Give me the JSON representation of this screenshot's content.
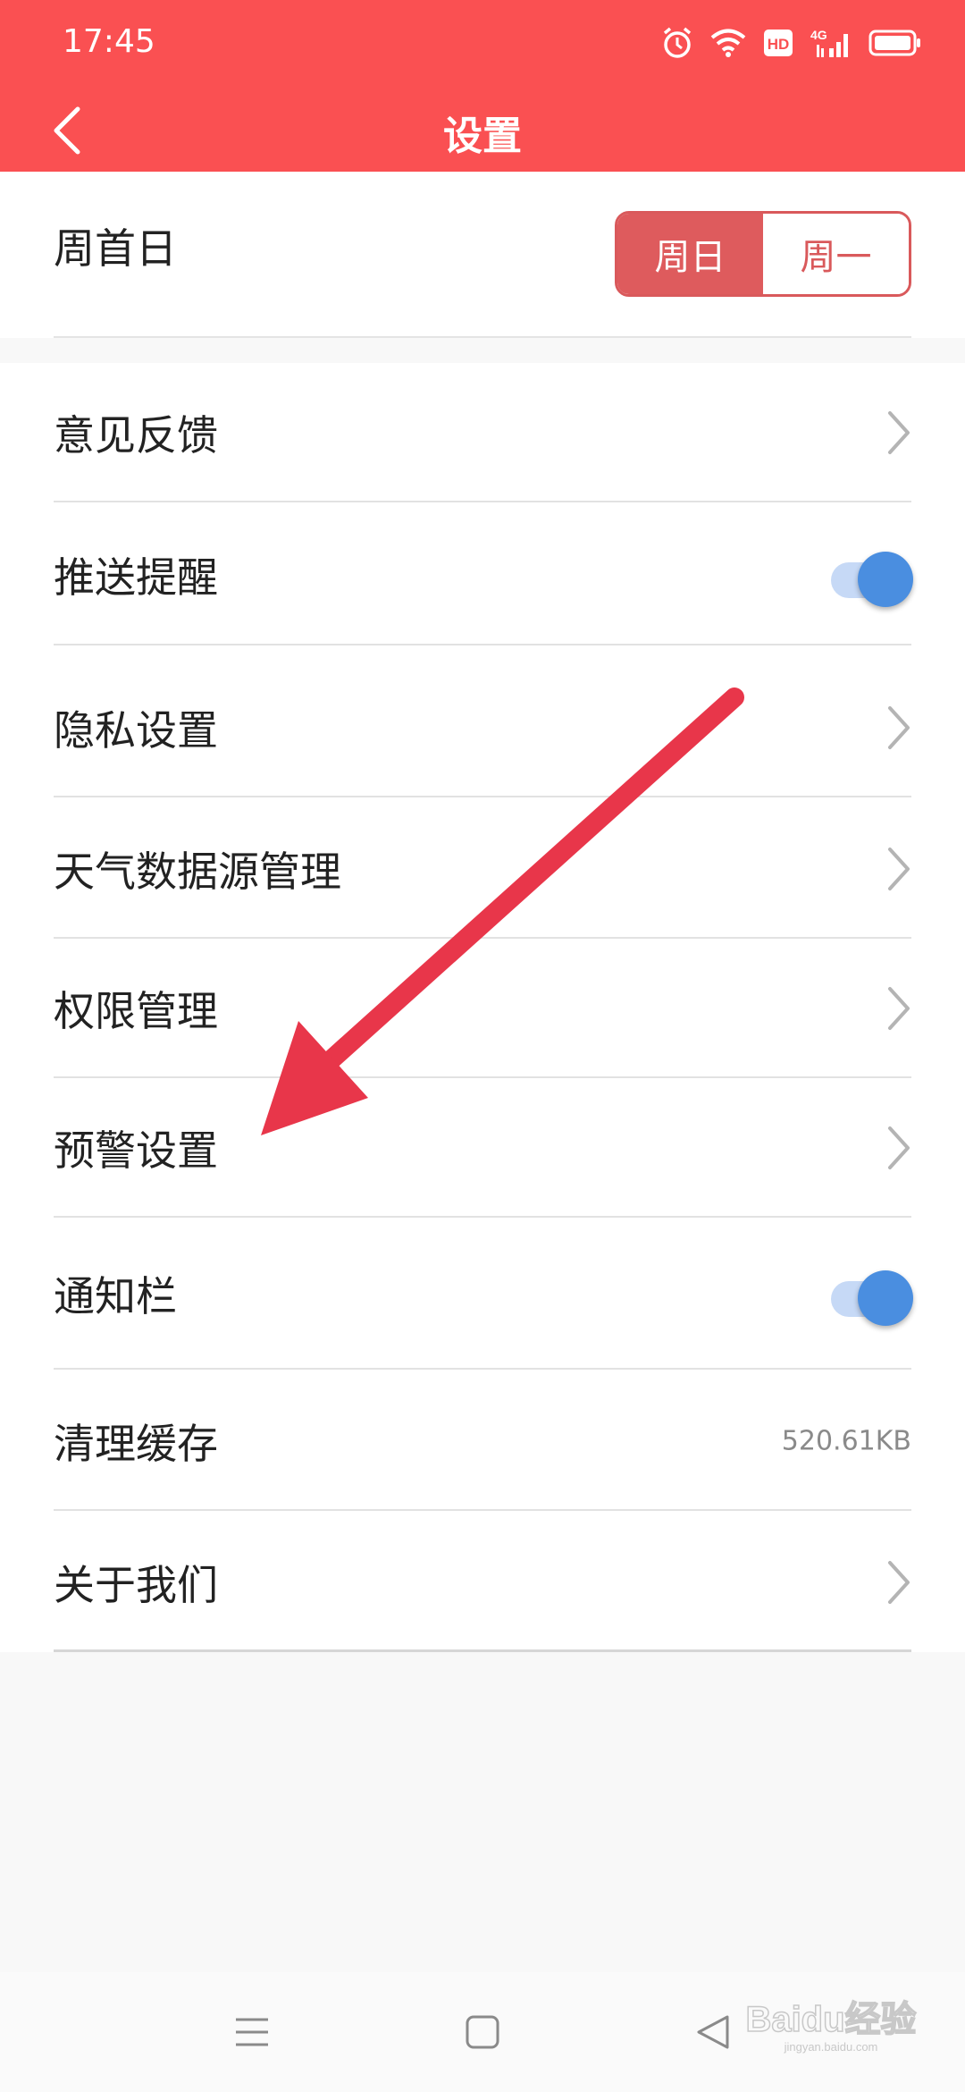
{
  "status_bar": {
    "time": "17:45",
    "icons": [
      "alarm-icon",
      "wifi-icon",
      "hd-icon",
      "signal-4g-icon",
      "battery-icon"
    ],
    "hd_text": "HD",
    "network_text": "4G"
  },
  "header": {
    "title": "设置",
    "background": "#fa5052"
  },
  "week_start": {
    "label": "周首日",
    "options": [
      {
        "label": "周日",
        "selected": true
      },
      {
        "label": "周一",
        "selected": false
      }
    ],
    "accent": "#d9595b"
  },
  "settings": {
    "items": [
      {
        "label": "意见反馈",
        "control": "chevron"
      },
      {
        "label": "推送提醒",
        "control": "toggle",
        "on": true
      },
      {
        "label": "隐私设置",
        "control": "chevron"
      },
      {
        "label": "天气数据源管理",
        "control": "chevron"
      },
      {
        "label": "权限管理",
        "control": "chevron"
      },
      {
        "label": "预警设置",
        "control": "chevron"
      },
      {
        "label": "通知栏",
        "control": "toggle",
        "on": true
      },
      {
        "label": "清理缓存",
        "control": "value",
        "value": "520.61KB"
      },
      {
        "label": "关于我们",
        "control": "chevron"
      }
    ]
  },
  "annotation": {
    "arrow_color": "#e8364a"
  },
  "nav_bar": {
    "buttons": [
      "menu-icon",
      "home-icon",
      "back-triangle-icon"
    ]
  },
  "watermark": {
    "text": "Baidu经验",
    "subtext": "jingyan.baidu.com"
  }
}
